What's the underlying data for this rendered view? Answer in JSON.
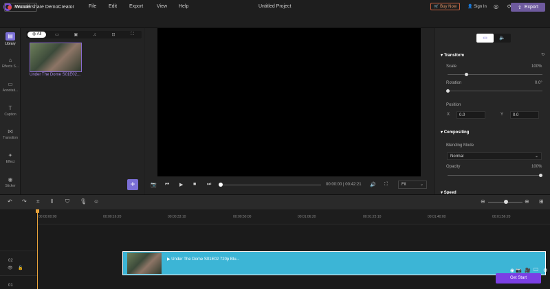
{
  "titlebar": {
    "app_title": "Wondershare DemoCreator",
    "menus": [
      "File",
      "Edit",
      "Export",
      "View",
      "Help"
    ],
    "project": "Untitled Project",
    "buy_now": "Buy Now",
    "sign_in": "Sign In"
  },
  "toolbar2": {
    "record": "Record",
    "export": "Export"
  },
  "tools": [
    {
      "label": "Library",
      "icon": "library-icon"
    },
    {
      "label": "Effects S...",
      "icon": "effects-icon"
    },
    {
      "label": "Annotati...",
      "icon": "annotation-icon"
    },
    {
      "label": "Caption",
      "icon": "caption-icon"
    },
    {
      "label": "Transition",
      "icon": "transition-icon"
    },
    {
      "label": "Effect",
      "icon": "effect-icon"
    },
    {
      "label": "Sticker",
      "icon": "sticker-icon"
    }
  ],
  "media": {
    "tab_all": "All",
    "clip_name": "Under The Dome S01E02..."
  },
  "player": {
    "timecode": "00:00:00 | 00:42:21",
    "fit": "Fit",
    "progress": 0.0
  },
  "props": {
    "transform": "Transform",
    "scale_label": "Scale",
    "scale_value": "100%",
    "rotation_label": "Rotation",
    "rotation_value": "0.0°",
    "position_label": "Position",
    "x_label": "X",
    "x_value": "0.0",
    "y_label": "Y",
    "y_value": "0.0",
    "compositing": "Compositing",
    "blending_label": "Blending Mode",
    "blending_value": "Normal",
    "opacity_label": "Opacity",
    "opacity_value": "100%",
    "speed": "Speed"
  },
  "timeline": {
    "ruler": [
      "00:00:00:00",
      "00:00:16:20",
      "00:00:33:10",
      "00:00:50:00",
      "00:01:06:20",
      "00:01:23:10",
      "00:01:40:00",
      "00:01:56:20"
    ],
    "track2": "02",
    "track1": "01",
    "clip_label": "Under The Dome S01E02  720p Blu...",
    "get_start": "Get Start"
  }
}
